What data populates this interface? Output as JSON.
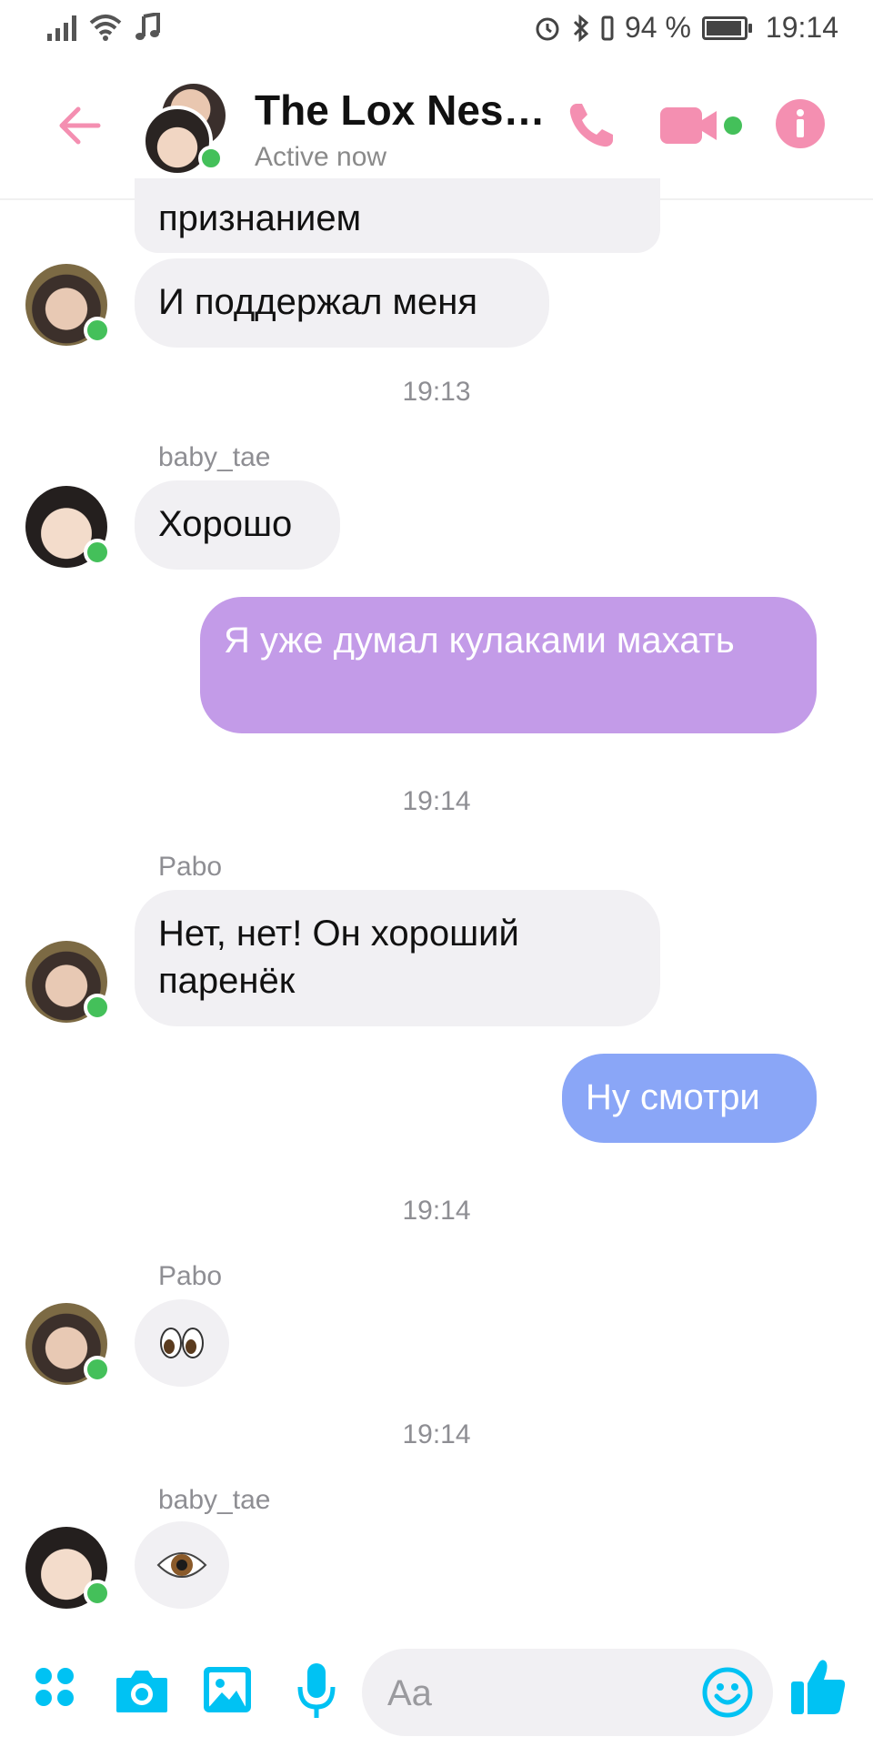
{
  "status_bar": {
    "battery": "94 %",
    "time": "19:14",
    "battery_level": 0.94
  },
  "header": {
    "title": "The Lox Nes…",
    "subtitle": "Active now"
  },
  "colors": {
    "accent": "#f48fb1",
    "online": "#44c05a",
    "outgoing_purple": "#c39be8",
    "outgoing_blue": "#8aa6f7",
    "composer_icon": "#00c2f3"
  },
  "messages": [
    {
      "type": "incoming",
      "text": "признанием"
    },
    {
      "type": "incoming",
      "text": "И поддержал меня"
    },
    {
      "type": "time",
      "text": "19:13"
    },
    {
      "type": "sender",
      "text": "baby_tae"
    },
    {
      "type": "incoming",
      "text": "Хорошо"
    },
    {
      "type": "outgoing",
      "text": "Я уже думал кулаками махать"
    },
    {
      "type": "time",
      "text": "19:14"
    },
    {
      "type": "sender",
      "text": "Pabo"
    },
    {
      "type": "incoming",
      "text": "Нет, нет! Он хороший паренёк"
    },
    {
      "type": "outgoing",
      "text": "Ну смотри"
    },
    {
      "type": "time",
      "text": "19:14"
    },
    {
      "type": "sender",
      "text": "Pabo"
    },
    {
      "type": "emoji",
      "text": "eyes-emoji"
    },
    {
      "type": "time",
      "text": "19:14"
    },
    {
      "type": "sender",
      "text": "baby_tae"
    },
    {
      "type": "emoji",
      "text": "eye-emoji"
    }
  ],
  "composer": {
    "placeholder": "Aa"
  }
}
